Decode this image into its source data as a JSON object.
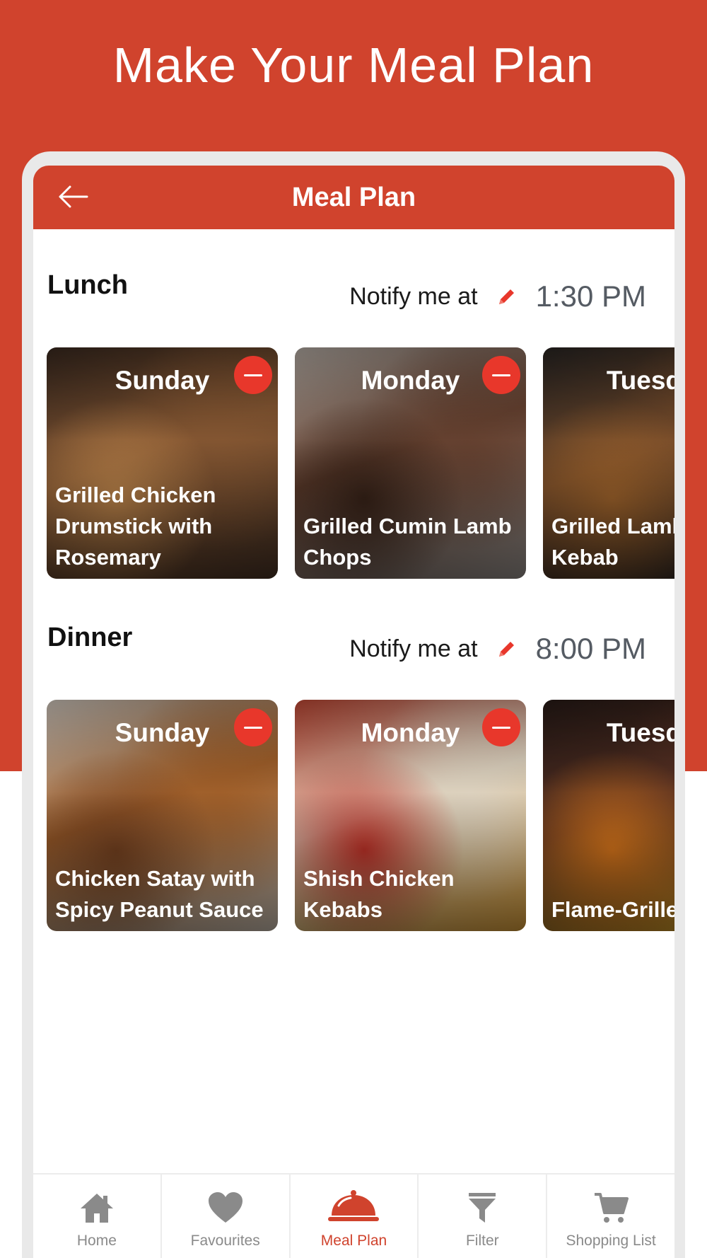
{
  "promo": {
    "title": "Make Your Meal Plan"
  },
  "header": {
    "title": "Meal Plan",
    "back_icon": "arrow-left-icon"
  },
  "lunch": {
    "title": "Lunch",
    "notify_label": "Notify me at",
    "time": "1:30 PM",
    "cards": [
      {
        "day": "Sunday",
        "name": "Grilled Chicken Drumstick with Rosemary",
        "colors": [
          "#3b2a20",
          "#8a5a34",
          "#c58a4e",
          "#4a3426"
        ]
      },
      {
        "day": "Monday",
        "name": "Grilled Cumin Lamb Chops",
        "colors": [
          "#b9b0a8",
          "#6a4432",
          "#3a2419",
          "#9a9490"
        ]
      },
      {
        "day": "Tuesday",
        "name": "Grilled Lamb Tikka Kebab",
        "colors": [
          "#2a2624",
          "#7a4e2c",
          "#a8692e",
          "#2b2623"
        ]
      }
    ]
  },
  "dinner": {
    "title": "Dinner",
    "notify_label": "Notify me at",
    "time": "8:00 PM",
    "cards": [
      {
        "day": "Sunday",
        "name": "Chicken Satay with Spicy Peanut Sauce",
        "colors": [
          "#d8cfc5",
          "#a8642c",
          "#7a4421",
          "#cfc3b5"
        ]
      },
      {
        "day": "Monday",
        "name": "Shish Chicken Kebabs",
        "colors": [
          "#c84a36",
          "#e8dcc8",
          "#c7342a",
          "#e0a23a"
        ]
      },
      {
        "day": "Tuesday",
        "name": "Flame-Grilled Steak",
        "colors": [
          "#2a1c18",
          "#5a3224",
          "#e07a1c",
          "#f3b62a"
        ]
      }
    ]
  },
  "nav": [
    {
      "label": "Home",
      "icon": "home-icon",
      "active": false
    },
    {
      "label": "Favourites",
      "icon": "heart-icon",
      "active": false
    },
    {
      "label": "Meal Plan",
      "icon": "cloche-icon",
      "active": true
    },
    {
      "label": "Filter",
      "icon": "filter-icon",
      "active": false
    },
    {
      "label": "Shopping List",
      "icon": "cart-icon",
      "active": false
    }
  ],
  "colors": {
    "brand": "#d0432d",
    "remove": "#e8372b",
    "nav_inactive": "#8a8a8a"
  }
}
